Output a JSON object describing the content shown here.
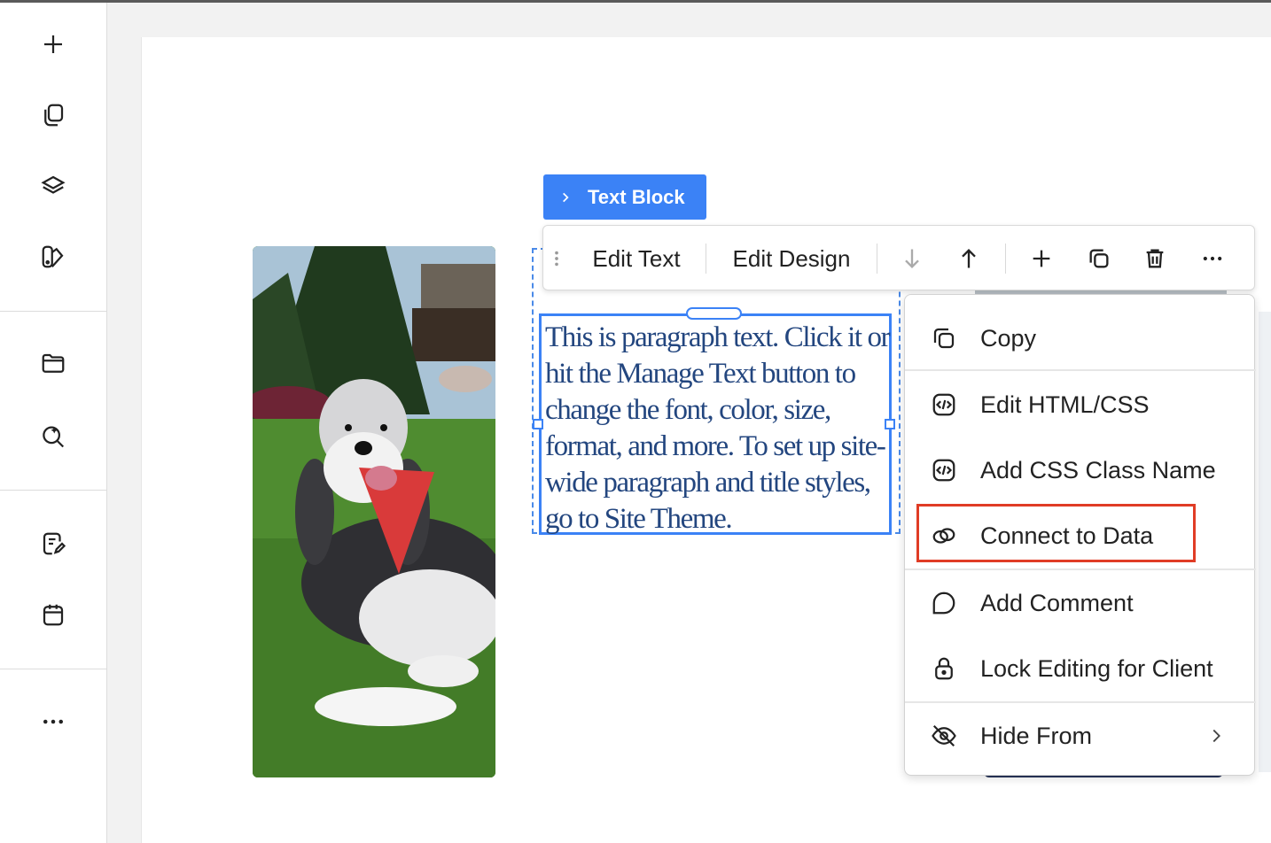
{
  "rail": {
    "icons": [
      "add-icon",
      "pages-icon",
      "layers-icon",
      "site-design-icon",
      "media-folder-icon",
      "ai-search-icon",
      "blog-icon",
      "bookings-calendar-icon",
      "more-icon"
    ]
  },
  "block_label": {
    "text": "Text Block"
  },
  "toolbar": {
    "edit_text": "Edit Text",
    "edit_design": "Edit Design"
  },
  "paragraph": {
    "text": "This is paragraph text. Click it or hit the Manage Text button to change the font, color, size, format, and more. To set up site-wide paragraph and title styles, go to Site Theme."
  },
  "context_menu": {
    "items": [
      {
        "label": "Copy",
        "icon": "copy-icon"
      },
      {
        "label": "Edit HTML/CSS",
        "icon": "code-icon"
      },
      {
        "label": "Add CSS Class Name",
        "icon": "code-icon"
      },
      {
        "label": "Connect to Data",
        "icon": "link-data-icon",
        "highlighted": true
      },
      {
        "label": "Add Comment",
        "icon": "comment-icon"
      },
      {
        "label": "Lock Editing for Client",
        "icon": "lock-icon"
      },
      {
        "label": "Hide From",
        "icon": "eye-off-icon",
        "has_submenu": true
      }
    ]
  },
  "colors": {
    "accent": "#3b82f6",
    "highlight": "#e03c25",
    "paragraph_text": "#23467f"
  }
}
